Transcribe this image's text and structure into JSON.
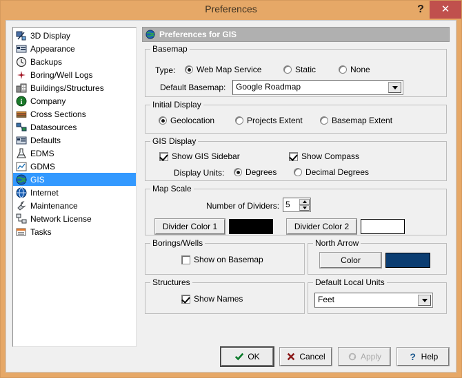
{
  "window": {
    "title": "Preferences",
    "help_icon": "question-mark-icon",
    "close_label": "✕"
  },
  "sidebar": {
    "items": [
      {
        "label": "3D Display",
        "icon": "3d-display-icon",
        "selected": false
      },
      {
        "label": "Appearance",
        "icon": "appearance-icon",
        "selected": false
      },
      {
        "label": "Backups",
        "icon": "clock-icon",
        "selected": false
      },
      {
        "label": "Boring/Well Logs",
        "icon": "star-marker-icon",
        "selected": false
      },
      {
        "label": "Buildings/Structures",
        "icon": "building-icon",
        "selected": false
      },
      {
        "label": "Company",
        "icon": "info-circle-icon",
        "selected": false
      },
      {
        "label": "Cross Sections",
        "icon": "cross-section-icon",
        "selected": false
      },
      {
        "label": "Datasources",
        "icon": "datasource-icon",
        "selected": false
      },
      {
        "label": "Defaults",
        "icon": "defaults-icon",
        "selected": false
      },
      {
        "label": "EDMS",
        "icon": "flask-icon",
        "selected": false
      },
      {
        "label": "GDMS",
        "icon": "chart-icon",
        "selected": false
      },
      {
        "label": "GIS",
        "icon": "globe-icon",
        "selected": true
      },
      {
        "label": "Internet",
        "icon": "globe-network-icon",
        "selected": false
      },
      {
        "label": "Maintenance",
        "icon": "wrench-icon",
        "selected": false
      },
      {
        "label": "Network License",
        "icon": "network-icon",
        "selected": false
      },
      {
        "label": "Tasks",
        "icon": "tasks-icon",
        "selected": false
      }
    ]
  },
  "panel": {
    "header_title": "Preferences for GIS",
    "header_icon": "globe-icon"
  },
  "basemap": {
    "legend": "Basemap",
    "type_label": "Type:",
    "options": [
      {
        "label": "Web Map Service",
        "selected": true
      },
      {
        "label": "Static",
        "selected": false
      },
      {
        "label": "None",
        "selected": false
      }
    ],
    "default_label": "Default Basemap:",
    "default_value": "Google Roadmap"
  },
  "initial_display": {
    "legend": "Initial Display",
    "options": [
      {
        "label": "Geolocation",
        "selected": true
      },
      {
        "label": "Projects Extent",
        "selected": false
      },
      {
        "label": "Basemap Extent",
        "selected": false
      }
    ]
  },
  "gis_display": {
    "legend": "GIS Display",
    "show_sidebar": {
      "label": "Show GIS Sidebar",
      "checked": true
    },
    "show_compass": {
      "label": "Show Compass",
      "checked": true
    },
    "units_label": "Display Units:",
    "units_options": [
      {
        "label": "Degrees",
        "selected": true
      },
      {
        "label": "Decimal Degrees",
        "selected": false
      }
    ]
  },
  "map_scale": {
    "legend": "Map Scale",
    "dividers_label": "Number of Dividers:",
    "dividers_value": "5",
    "color1_button": "Divider Color 1",
    "color1_value": "#000000",
    "color2_button": "Divider Color 2",
    "color2_value": "#ffffff"
  },
  "borings_wells": {
    "legend": "Borings/Wells",
    "show_on_basemap": {
      "label": "Show on Basemap",
      "checked": false
    }
  },
  "north_arrow": {
    "legend": "North Arrow",
    "color_button": "Color",
    "color_value": "#0b3d72"
  },
  "structures": {
    "legend": "Structures",
    "show_names": {
      "label": "Show Names",
      "checked": true
    }
  },
  "default_local_units": {
    "legend": "Default Local Units",
    "value": "Feet"
  },
  "buttons": {
    "ok": {
      "label": "OK",
      "icon": "check-icon",
      "enabled": true
    },
    "cancel": {
      "label": "Cancel",
      "icon": "x-icon",
      "enabled": true
    },
    "apply": {
      "label": "Apply",
      "icon": "refresh-icon",
      "enabled": false
    },
    "help": {
      "label": "Help",
      "icon": "question-icon",
      "enabled": true
    }
  },
  "colors": {
    "titlebar": "#e6a867",
    "close": "#c0504d",
    "selection": "#3399ff",
    "panel_header": "#b0b0b0"
  }
}
